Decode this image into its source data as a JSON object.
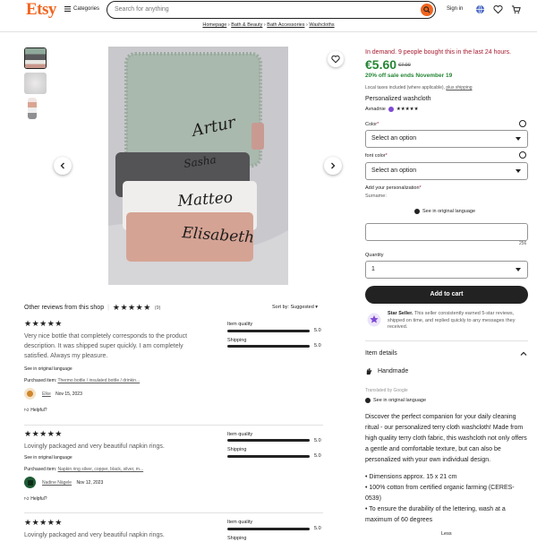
{
  "header": {
    "logo": "Etsy",
    "categories": "Categories",
    "search_placeholder": "Search for anything",
    "sign_in": "Sign in"
  },
  "breadcrumb": [
    "Homepage",
    "Bath & Beauty",
    "Bath Accessories",
    "Washcloths"
  ],
  "image_text": {
    "name1": "Artur",
    "name2": "Elisabeth",
    "name3": "Matteo",
    "name4": "Sasha"
  },
  "product": {
    "demand": "In demand. 9 people bought this in the last 24 hours.",
    "price": "€5.60",
    "old_price": "€7.00",
    "sale": "20% off sale ends November 19",
    "taxes": "Local taxes included (where applicable),",
    "shipping_link": "plus shipping",
    "title": "Personalized washcloth",
    "shop_name": "Avnadnie",
    "shop_stars": "★★★★★",
    "color_label": "Color",
    "color_value": "Select an option",
    "font_label": "font color",
    "font_value": "Select an option",
    "personalization_label": "Add your personalization",
    "personalization_hint": "Surname:",
    "see_original": "See in original language",
    "char_count": "256",
    "quantity_label": "Quantity",
    "quantity_value": "1",
    "add_to_cart": "Add to cart",
    "star_seller_title": "Star Seller.",
    "star_seller_text": " This seller consistently earned 5-star reviews, shipped on time, and replied quickly to any messages they received.",
    "item_details": "Item details",
    "handmade": "Handmade",
    "translated": "Translated by Google",
    "see_original_2": "See in original language",
    "description": "Discover the perfect companion for your daily cleaning ritual - our personalized terry cloth washcloth! Made from high quality terry cloth fabric, this washcloth not only offers a gentle and comfortable texture, but can also be personalized with your own individual design.",
    "bullets": [
      "• Dimensions approx. 15 x 21 cm",
      "• 100% cotton from certified organic farming (CERES-0539)",
      "• To ensure the durability of the lettering, wash at a maximum of 60 degrees"
    ],
    "less": "Less"
  },
  "reviews": {
    "title": "Other reviews from this shop",
    "stars": "★★★★★",
    "count": "(9)",
    "sort": "Sort by: Suggested",
    "item_quality_label": "Item quality",
    "shipping_label": "Shipping",
    "items": [
      {
        "stars": "★★★★★",
        "text": "Very nice bottle that completely corresponds to the product description. It was shipped super quickly. I am completely satisfied. Always my pleasure.",
        "see_original": "See in original language",
        "purchased_label": "Purchased item:",
        "purchased_item": "Thermo bottle / insulated bottle / drinkin...",
        "author": "Elke",
        "date": "Nov 15, 2023",
        "helpful": "Helpful?",
        "item_quality": "5.0",
        "shipping": "5.0"
      },
      {
        "stars": "★★★★★",
        "text": "Lovingly packaged and very beautiful napkin rings.",
        "see_original": "See in original language",
        "purchased_label": "Purchased item:",
        "purchased_item": "Napkin ring silver, copper, black, silver, m...",
        "author": "Nadine Nägele",
        "date": "Nov 12, 2023",
        "helpful": "Helpful?",
        "item_quality": "5.0",
        "shipping": "5.0"
      },
      {
        "stars": "★★★★★",
        "text": "Lovingly packaged and very beautiful napkin rings.",
        "item_quality": "5.0",
        "shipping": ""
      }
    ]
  },
  "colors": {
    "accent": "#f1641e",
    "price_green": "#258635",
    "demand_red": "#a61a2e"
  }
}
